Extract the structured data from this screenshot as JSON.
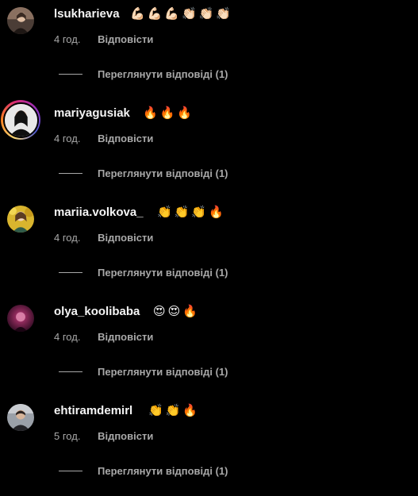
{
  "comments": [
    {
      "username": "lsukharieva",
      "emojis": "💪🏻💪🏻💪🏻👏🏻👏🏻👏🏻",
      "time": "4 год.",
      "reply_label": "Відповісти",
      "view_replies": "Переглянути відповіді (1)",
      "has_story": false,
      "avatar_colors": [
        "#5a4a42",
        "#c9a58a"
      ]
    },
    {
      "username": "mariyagusiak",
      "emojis": "🔥🔥🔥",
      "time": "4 год.",
      "reply_label": "Відповісти",
      "view_replies": "Переглянути відповіді (1)",
      "has_story": true,
      "avatar_colors": [
        "#1a1a1a",
        "#d8d8d8"
      ]
    },
    {
      "username": "mariia.volkova_",
      "emojis": "👏👏👏🔥",
      "time": "4 год.",
      "reply_label": "Відповісти",
      "view_replies": "Переглянути відповіді (1)",
      "has_story": false,
      "avatar_colors": [
        "#e4c23a",
        "#f0d9c4"
      ]
    },
    {
      "username": "olya_koolibaba",
      "emojis": "😍😍🔥",
      "time": "4 год.",
      "reply_label": "Відповісти",
      "view_replies": "Переглянути відповіді (1)",
      "has_story": false,
      "avatar_colors": [
        "#3a0f2a",
        "#b0306a"
      ]
    },
    {
      "username": "ehtiramdemirl",
      "emojis": "👏👏🔥",
      "time": "5 год.",
      "reply_label": "Відповісти",
      "view_replies": "Переглянути відповіді (1)",
      "has_story": false,
      "avatar_colors": [
        "#8a8f98",
        "#2b2b30"
      ]
    }
  ]
}
